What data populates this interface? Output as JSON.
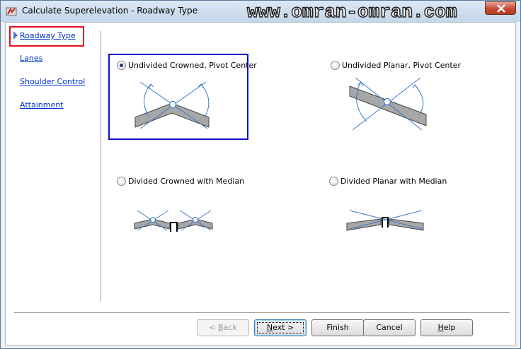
{
  "window": {
    "title": "Calculate Superelevation - Roadway Type",
    "watermark": "www.omran-omran.com"
  },
  "nav": {
    "items": [
      {
        "label": "Roadway Type",
        "selected": true
      },
      {
        "label": "Lanes"
      },
      {
        "label": "Shoulder Control"
      },
      {
        "label": "Attainment"
      }
    ]
  },
  "options": [
    {
      "label": "Undivided Crowned, Pivot Center",
      "checked": true
    },
    {
      "label": "Undivided Planar, Pivot Center",
      "checked": false
    },
    {
      "label": "Divided Crowned with Median",
      "checked": false
    },
    {
      "label": "Divided Planar with Median",
      "checked": false
    }
  ],
  "buttons": {
    "back": {
      "prefix": "< ",
      "mnemonic": "B",
      "rest": "ack",
      "enabled": false
    },
    "next": {
      "mnemonic": "N",
      "rest": "ext >"
    },
    "finish": {
      "label": "Finish"
    },
    "cancel": {
      "label": "Cancel"
    },
    "help": {
      "mnemonic": "H",
      "rest": "elp"
    }
  },
  "colors": {
    "accent_line": "#3d79c6",
    "selection_outline_red": "#e8101a",
    "selection_outline_blue": "#1010d0"
  },
  "icons": [
    "app-icon",
    "close-icon",
    "nav-arrow-icon"
  ]
}
